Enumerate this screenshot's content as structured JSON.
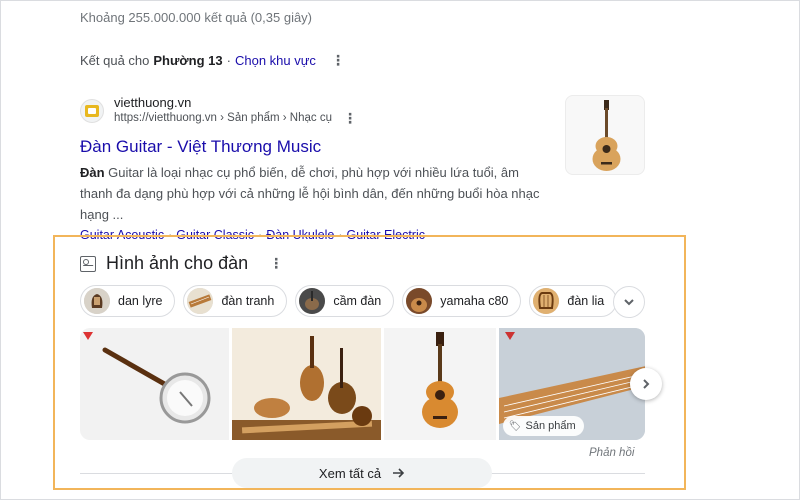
{
  "stats": {
    "text": "Khoảng 255.000.000 kết quả (0,35 giây)"
  },
  "location": {
    "prefix": "Kết quả cho",
    "place": "Phường 13",
    "separator": "·",
    "change_link": "Chọn khu vực"
  },
  "result": {
    "site_name": "vietthuong.vn",
    "breadcrumb": "https://vietthuong.vn › Sản phẩm › Nhạc cụ",
    "title": "Đàn Guitar - Việt Thương Music",
    "snippet_bold": "Đàn",
    "snippet_rest": " Guitar là loại nhạc cụ phổ biến, dễ chơi, phù hợp với nhiều lứa tuổi, âm thanh đa dạng phù hợp với cả những lễ hội bình dân, đến những buổi hòa nhạc hạng ...",
    "sitelinks": [
      "Guitar Acoustic",
      "Guitar Classic",
      "Đàn Ukulele",
      "Guitar Electric"
    ],
    "sitelink_separator": "·"
  },
  "images": {
    "title": "Hình ảnh cho đàn",
    "chips": [
      {
        "label": "dan lyre"
      },
      {
        "label": "đàn tranh"
      },
      {
        "label": "cầm đàn"
      },
      {
        "label": "yamaha c80"
      },
      {
        "label": "đàn lia"
      }
    ],
    "product_tag": "Sản phẩm",
    "feedback": "Phản hồi",
    "see_all": "Xem tất cả"
  },
  "colors": {
    "link": "#1a0dab",
    "highlight_border": "#f2b55a",
    "secondary_text": "#70757a"
  },
  "icons": {
    "favicon": "vietthuong-logo-icon",
    "images": "image-icon",
    "more": "more-vert-icon",
    "expand": "chevron-down-icon",
    "next": "chevron-right-icon",
    "tag": "tag-icon",
    "arrow": "arrow-right-icon"
  }
}
